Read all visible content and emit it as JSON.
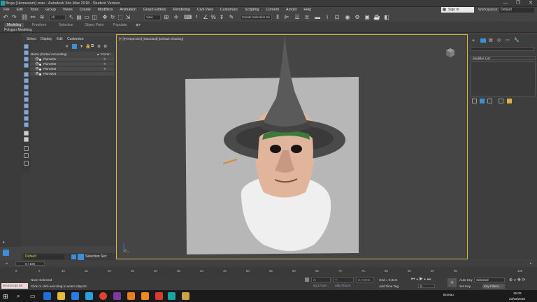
{
  "window": {
    "title": "Bruja (Homework).max - Autodesk 3ds Max 2018 - Student Version",
    "controls": [
      "—",
      "❐",
      "✕"
    ]
  },
  "menu": [
    "File",
    "Edit",
    "Tools",
    "Group",
    "Views",
    "Create",
    "Modifiers",
    "Animation",
    "Graph Editors",
    "Rendering",
    "Civil View",
    "Customize",
    "Scripting",
    "Content",
    "Arnold",
    "Help"
  ],
  "signin": "Sign In",
  "workspace": {
    "label": "Workspaces:",
    "value": "Default"
  },
  "toolbar": {
    "filter": "All",
    "view": "View",
    "selset": "Create Selection Se"
  },
  "ribbon": {
    "tabs": [
      "Modeling",
      "Freeform",
      "Selection",
      "Object Paint",
      "Populate"
    ],
    "active": "Modeling",
    "sub": "Polygon Modeling"
  },
  "explorer": {
    "menu": [
      "Select",
      "Display",
      "Edit",
      "Customize"
    ],
    "header_name": "Name (Sorted Ascending)",
    "header_frozen": "▲ Frozen",
    "rows": [
      {
        "name": "Plane001",
        "frozen": "❄"
      },
      {
        "name": "Plane002",
        "frozen": "❄"
      },
      {
        "name": "Plane003",
        "frozen": "❄"
      },
      {
        "name": "Plane004",
        "frozen": ""
      }
    ],
    "layer": "Default",
    "selection_set": "Selection Set:"
  },
  "viewport": {
    "label": "[+] [Perspective] [Standard] [Default Shading]"
  },
  "command_panel": {
    "modifier_list": "Modifier List"
  },
  "timeline": {
    "frame": "0 / 100",
    "ticks": [
      "0",
      "5",
      "10",
      "15",
      "20",
      "25",
      "30",
      "35",
      "40",
      "45",
      "50",
      "55",
      "60",
      "65",
      "70",
      "75",
      "80",
      "85",
      "90",
      "95",
      "100"
    ]
  },
  "status": {
    "maxscript": "MAXScript Mi",
    "line1": "None Selected",
    "line2": "Click or click-and-drag to select objects",
    "x": "X: 63,174cm",
    "y": "Y: 465,761cm",
    "z": "Z: 0,0cm",
    "grid": "Grid = 0,0cm",
    "addtimetag": "Add Time Tag",
    "autokey": "Auto Key",
    "selected": "Selected",
    "setkey": "Set Key",
    "keyfilters": "Key Filters...",
    "frame_field": "0"
  },
  "taskbar": {
    "location": "Bureau",
    "time": "15:09",
    "date": "23/03/2018"
  },
  "colors": {
    "viewport_border": "#d6b24a",
    "layer_text": "#e7c24a",
    "accent_blue": "#3a8fd6"
  }
}
